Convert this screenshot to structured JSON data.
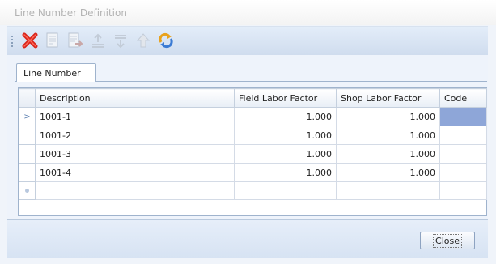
{
  "window": {
    "title": "Line Number Definition"
  },
  "toolbar": {
    "buttons": [
      {
        "name": "delete",
        "icon": "delete-x-icon",
        "enabled": true
      },
      {
        "name": "edit",
        "icon": "edit-document-icon",
        "enabled": false
      },
      {
        "name": "export",
        "icon": "export-document-icon",
        "enabled": false
      },
      {
        "name": "move-up",
        "icon": "move-up-icon",
        "enabled": false
      },
      {
        "name": "move-down",
        "icon": "move-down-icon",
        "enabled": false
      },
      {
        "name": "arrow-up",
        "icon": "arrow-up-icon",
        "enabled": false
      },
      {
        "name": "refresh",
        "icon": "refresh-icon",
        "enabled": true
      }
    ]
  },
  "tabs": [
    {
      "label": "Line Number",
      "active": true
    }
  ],
  "grid": {
    "columns": [
      "Description",
      "Field Labor Factor",
      "Shop Labor Factor",
      "Code"
    ],
    "rows": [
      {
        "description": "1001-1",
        "field_labor_factor": "1.000",
        "shop_labor_factor": "1.000",
        "code": "",
        "current": true
      },
      {
        "description": "1001-2",
        "field_labor_factor": "1.000",
        "shop_labor_factor": "1.000",
        "code": ""
      },
      {
        "description": "1001-3",
        "field_labor_factor": "1.000",
        "shop_labor_factor": "1.000",
        "code": ""
      },
      {
        "description": "1001-4",
        "field_labor_factor": "1.000",
        "shop_labor_factor": "1.000",
        "code": ""
      }
    ],
    "row_indicator": ">"
  },
  "footer": {
    "close_label": "Close"
  },
  "colors": {
    "selected_cell": "#8ea6d8",
    "toolbar_bg": "#d6e3f3",
    "border": "#9fb3cd",
    "delete_red": "#d9261c"
  }
}
